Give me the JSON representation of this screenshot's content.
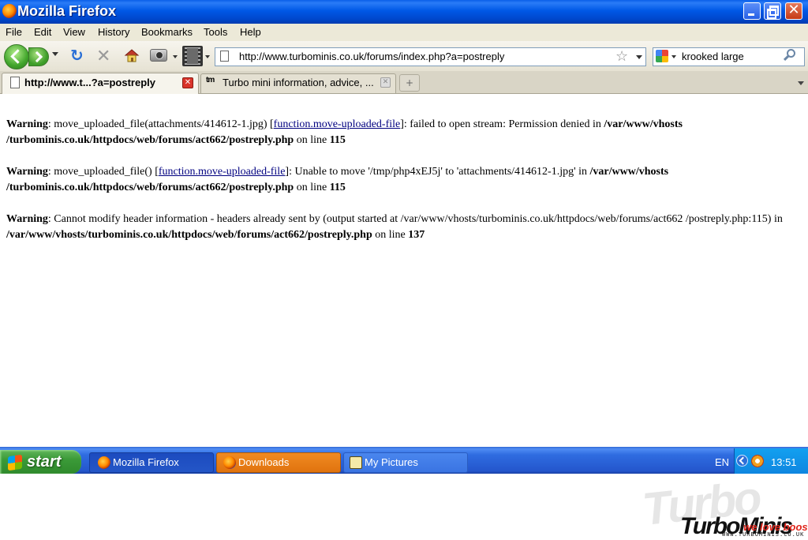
{
  "window": {
    "title": "Mozilla Firefox"
  },
  "menu": [
    {
      "label": "File"
    },
    {
      "label": "Edit"
    },
    {
      "label": "View"
    },
    {
      "label": "History"
    },
    {
      "label": "Bookmarks"
    },
    {
      "label": "Tools"
    },
    {
      "label": "Help"
    }
  ],
  "navbar": {
    "url": "http://www.turbominis.co.uk/forums/index.php?a=postreply",
    "search_value": "krooked large"
  },
  "tabs": [
    {
      "label": "http://www.t...?a=postreply",
      "active": true
    },
    {
      "label": "Turbo mini information, advice, ...",
      "favicon_text": "tm",
      "active": false
    }
  ],
  "content": {
    "warnings": [
      {
        "label": "Warning",
        "text1": ": move_uploaded_file(attachments/414612-1.jpg) [",
        "link": "function.move-uploaded-file",
        "text2": "]: failed to open stream: Permission denied in ",
        "path": "/var/www/vhosts /turbominis.co.uk/httpdocs/web/forums/act662/postreply.php",
        "text3": " on line ",
        "line": "115"
      },
      {
        "label": "Warning",
        "text1": ": move_uploaded_file() [",
        "link": "function.move-uploaded-file",
        "text2": "]: Unable to move '/tmp/php4xEJ5j' to 'attachments/414612-1.jpg' in ",
        "path": "/var/www/vhosts /turbominis.co.uk/httpdocs/web/forums/act662/postreply.php",
        "text3": " on line ",
        "line": "115"
      },
      {
        "label": "Warning",
        "text1": ": Cannot modify header information - headers already sent by (output started at /var/www/vhosts/turbominis.co.uk/httpdocs/web/forums/act662 /postreply.php:115) in ",
        "path": "/var/www/vhosts/turbominis.co.uk/httpdocs/web/forums/act662/postreply.php",
        "text3": " on line ",
        "line": "137"
      }
    ]
  },
  "taskbar": {
    "start_label": "start",
    "tasks": [
      {
        "label": "Mozilla Firefox"
      },
      {
        "label": "Downloads"
      },
      {
        "label": "My Pictures"
      }
    ],
    "language": "EN",
    "clock": "13:51"
  },
  "watermark": {
    "brand": "TurboMinis",
    "shadow": "Turbo",
    "slogan": "we love boost",
    "url": "WWW.TURBOMINIS.CO.UK"
  },
  "colors": {
    "titlebar": "#0058e6",
    "taskbar": "#2456cc",
    "start": "#3b9a38",
    "downloads_task": "#e0730e",
    "link": "#000080"
  }
}
